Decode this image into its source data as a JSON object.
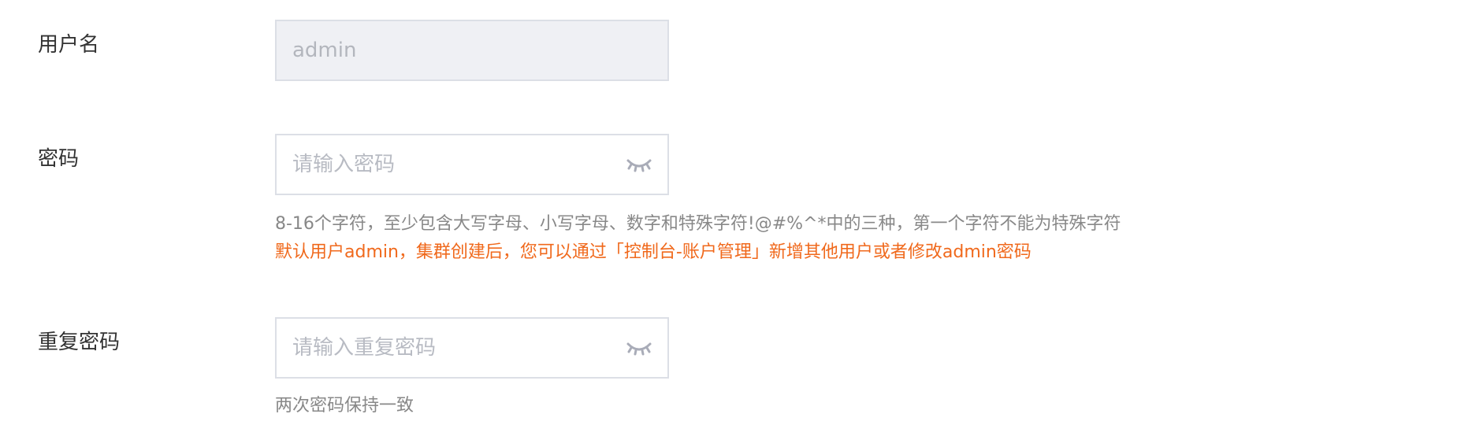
{
  "form": {
    "username": {
      "label": "用户名",
      "value": "admin"
    },
    "password": {
      "label": "密码",
      "placeholder": "请输入密码",
      "toggle_icon": "eye-closed-icon",
      "rule_hint": "8-16个字符，至少包含大写字母、小写字母、数字和特殊字符!@#%^*中的三种，第一个字符不能为特殊字符",
      "admin_note": "默认用户admin，集群创建后，您可以通过「控制台-账户管理」新增其他用户或者修改admin密码"
    },
    "confirm_password": {
      "label": "重复密码",
      "placeholder": "请输入重复密码",
      "toggle_icon": "eye-closed-icon",
      "hint": "两次密码保持一致"
    }
  },
  "colors": {
    "label_text": "#333333",
    "hint_text": "#888888",
    "warning_text": "#f0691c",
    "input_border": "#dcdfe6",
    "disabled_bg": "#eff0f4",
    "icon": "#a9acb8"
  }
}
